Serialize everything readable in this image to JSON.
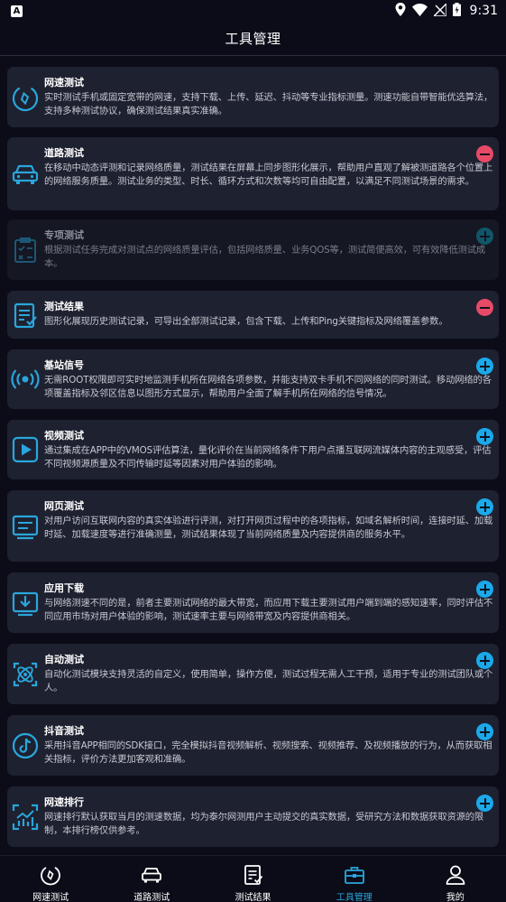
{
  "status_bar": {
    "left_badge": "A",
    "time": "9:31",
    "icons": [
      "location-icon",
      "wifi-icon",
      "signal-icon",
      "battery-icon"
    ]
  },
  "header": {
    "title": "工具管理"
  },
  "colors": {
    "background": "#0b0c18",
    "card": "#1e2130",
    "accent": "#1aa9ea",
    "remove": "#e74a67",
    "icon_stroke": "#2aa6dc"
  },
  "tools": [
    {
      "id": "speed",
      "title": "网速测试",
      "desc": "实时测试手机或固定宽带的网速，支持下载、上传、延迟、抖动等专业指标测量。测速功能自带智能优选算法，支持多种测试协议，确保测试结果真实准确。",
      "action": "none",
      "icon": "speed-gauge-icon",
      "enabled": true
    },
    {
      "id": "road",
      "title": "道路测试",
      "desc": "在移动中动态评测和记录网络质量，测试结果在屏幕上同步图形化展示，帮助用户直观了解被测道路各个位置上的网络服务质量。测试业务的类型、时长、循环方式和次数等均可自由配置，以满足不同测试场景的需求。",
      "action": "remove",
      "icon": "car-icon",
      "enabled": true
    },
    {
      "id": "special",
      "title": "专项测试",
      "desc": "根据测试任务完成对测试点的网络质量评估，包括网络质量、业务QOS等，测试简便高效，可有效降低测试成本。",
      "action": "add",
      "icon": "clipboard-check-icon",
      "enabled": false
    },
    {
      "id": "results",
      "title": "测试结果",
      "desc": "图形化展现历史测试记录，可导出全部测试记录，包含下载、上传和Ping关键指标及网络覆盖参数。",
      "action": "remove",
      "icon": "report-icon",
      "enabled": true
    },
    {
      "id": "cell",
      "title": "基站信号",
      "desc": "无需ROOT权限即可实时地监测手机所在网络各项参数，并能支持双卡手机不同网络的同时测试。移动网络的各项覆盖指标及邻区信息以图形方式显示，帮助用户全面了解手机所在网络的信号情况。",
      "action": "add",
      "icon": "antenna-icon",
      "enabled": true
    },
    {
      "id": "video",
      "title": "视频测试",
      "desc": "通过集成在APP中的VMOS评估算法，量化评价在当前网络条件下用户点播互联网流媒体内容的主观感受，评估不同视频源质量及不同传输时延等因素对用户体验的影响。",
      "action": "add",
      "icon": "play-icon",
      "enabled": true
    },
    {
      "id": "web",
      "title": "网页测试",
      "desc": "对用户访问互联网内容的真实体验进行评测，对打开网页过程中的各项指标，如域名解析时间，连接时延、加载时延、加载速度等进行准确测量，测试结果体现了当前网络质量及内容提供商的服务水平。",
      "action": "add",
      "icon": "webpage-icon",
      "enabled": true
    },
    {
      "id": "download",
      "title": "应用下载",
      "desc": "与网络测速不同的是，前者主要测试网络的最大带宽，而应用下载主要测试用户端到端的感知速率，同时评估不同应用市场对用户体验的影响，测试速率主要与网络带宽及内容提供商相关。",
      "action": "add",
      "icon": "download-icon",
      "enabled": true
    },
    {
      "id": "auto",
      "title": "自动测试",
      "desc": "自动化测试模块支持灵活的自定义，使用简单，操作方便，测试过程无需人工干预，适用于专业的测试团队或个人。",
      "action": "add",
      "icon": "atom-icon",
      "enabled": true
    },
    {
      "id": "douyin",
      "title": "抖音测试",
      "desc": "采用抖音APP相同的SDK接口，完全模拟抖音视频解析、视频搜索、视频推荐、及视频播放的行为，从而获取相关指标，评价方法更加客观和准确。",
      "action": "add",
      "icon": "tiktok-icon",
      "enabled": true
    },
    {
      "id": "ranking",
      "title": "网速排行",
      "desc": "网速排行默认获取当月的测速数据，均为泰尔网测用户主动提交的真实数据，受研究方法和数据获取资源的限制，本排行榜仅供参考。",
      "action": "add",
      "icon": "ranking-chart-icon",
      "enabled": true
    }
  ],
  "nav": [
    {
      "label": "网速测试",
      "icon": "speed-gauge-icon",
      "active": false
    },
    {
      "label": "道路测试",
      "icon": "car-icon",
      "active": false
    },
    {
      "label": "测试结果",
      "icon": "report-icon",
      "active": false
    },
    {
      "label": "工具管理",
      "icon": "toolbox-icon",
      "active": true
    },
    {
      "label": "我的",
      "icon": "user-icon",
      "active": false
    }
  ]
}
